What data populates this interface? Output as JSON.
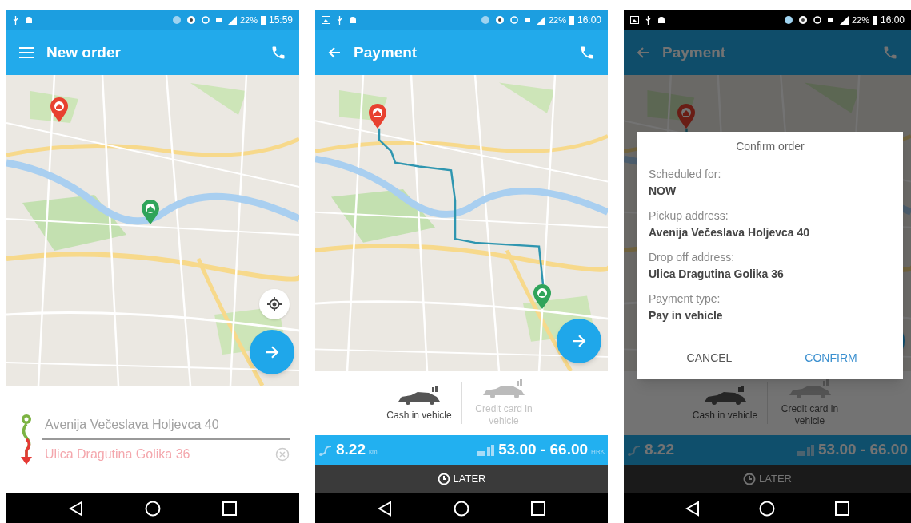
{
  "phones": [
    {
      "kind": "order",
      "dimmed": false,
      "status": {
        "battery": "22%",
        "time": "15:59"
      },
      "title": "New order",
      "nav": {
        "kind": "menu"
      },
      "pickup": "Avenija Večeslava Holjevca 40",
      "dropoff": "Ulica Dragutina Golika 36"
    },
    {
      "kind": "payment",
      "dimmed": false,
      "status": {
        "battery": "22%",
        "time": "16:00"
      },
      "title": "Payment",
      "nav": {
        "kind": "back"
      },
      "payment_options": [
        {
          "label": "Cash in vehicle",
          "selected": true
        },
        {
          "label": "Credit card in vehicle",
          "selected": false
        }
      ],
      "distance": "8.22",
      "distance_unit": "km",
      "price": "53.00 - 66.00",
      "currency": "HRK",
      "later_button": "LATER"
    },
    {
      "kind": "payment",
      "dimmed": true,
      "status": {
        "battery": "22%",
        "time": "16:00"
      },
      "title": "Payment",
      "nav": {
        "kind": "back"
      },
      "payment_options": [
        {
          "label": "Cash in vehicle",
          "selected": true
        },
        {
          "label": "Credit card in vehicle",
          "selected": false
        }
      ],
      "distance": "8.22",
      "price": "53.00 - 66.00",
      "later_button": "LATER",
      "dialog": {
        "title": "Confirm order",
        "fields": [
          {
            "label": "Scheduled for:",
            "value": "NOW"
          },
          {
            "label": "Pickup address:",
            "value": "Avenija Večeslava Holjevca 40"
          },
          {
            "label": "Drop off address:",
            "value": "Ulica Dragutina Golika 36"
          },
          {
            "label": "Payment type:",
            "value": "Pay in vehicle"
          }
        ],
        "cancel": "CANCEL",
        "confirm": "CONFIRM"
      }
    }
  ]
}
